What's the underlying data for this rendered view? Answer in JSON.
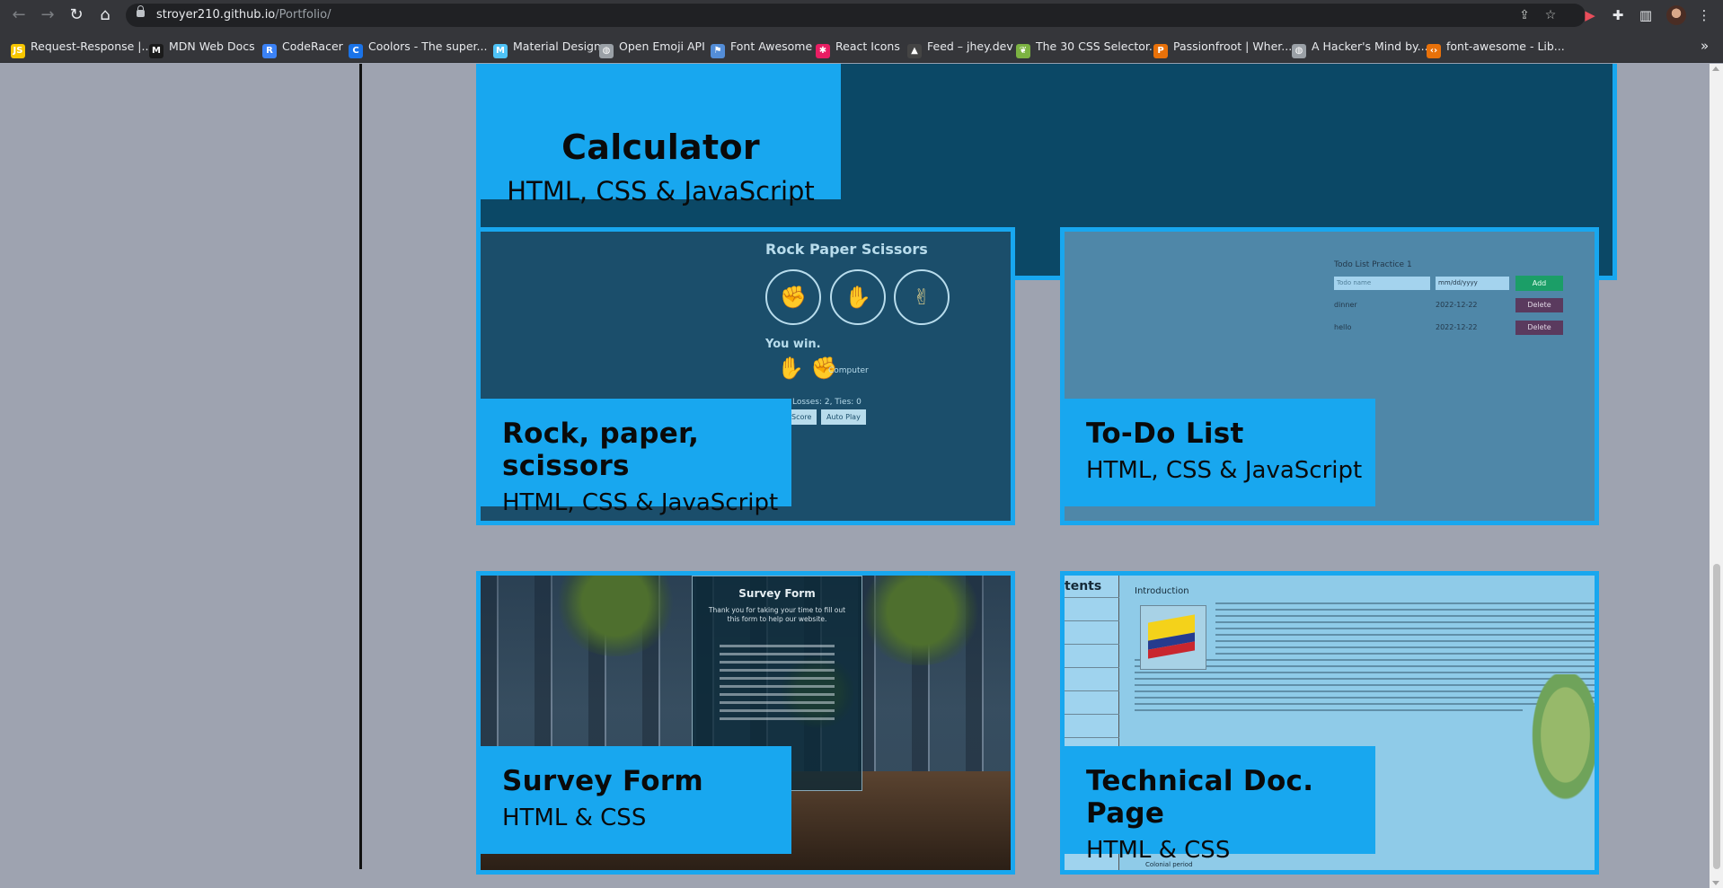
{
  "browser": {
    "url_host": "stroyer210.github.io",
    "url_path": "/Portfolio/",
    "bookmarks": [
      {
        "label": "Request-Response |...",
        "icon": "js-icon",
        "color": "#f7c600"
      },
      {
        "label": "MDN Web Docs",
        "icon": "mdn-icon",
        "color": "#1b1b1b"
      },
      {
        "label": "CodeRacer",
        "icon": "coderacer-icon",
        "color": "#3b82f6"
      },
      {
        "label": "Coolors - The super...",
        "icon": "coolors-icon",
        "color": "#1a73e8"
      },
      {
        "label": "Material Design",
        "icon": "material-icon",
        "color": "#4fc3f7"
      },
      {
        "label": "Open Emoji API",
        "icon": "globe-icon",
        "color": "#9aa0a6"
      },
      {
        "label": "Font Awesome",
        "icon": "flag-icon",
        "color": "#538dd7"
      },
      {
        "label": "React Icons",
        "icon": "react-icon",
        "color": "#e91e63"
      },
      {
        "label": "Feed – jhey.dev",
        "icon": "bear-icon",
        "color": "#444"
      },
      {
        "label": "The 30 CSS Selector...",
        "icon": "leaf-icon",
        "color": "#7cb342"
      },
      {
        "label": "Passionfroot | Wher...",
        "icon": "passionfroot-icon",
        "color": "#e8710a"
      },
      {
        "label": "A Hacker's Mind by...",
        "icon": "globe-icon",
        "color": "#9aa0a6"
      },
      {
        "label": "font-awesome - Lib...",
        "icon": "code-icon",
        "color": "#e8710a"
      }
    ]
  },
  "projects": {
    "calculator": {
      "title": "Calculator",
      "tech": "HTML, CSS & JavaScript"
    },
    "rps": {
      "title": "Rock, paper, scissors",
      "tech": "HTML, CSS & JavaScript",
      "preview": {
        "heading": "Rock Paper Scissors",
        "result": "You win.",
        "computer": "Computer",
        "score": "Losses: 2, Ties: 0",
        "reset": "Score",
        "autoplay": "Auto Play"
      }
    },
    "todo": {
      "title": "To-Do List",
      "tech": "HTML, CSS & JavaScript",
      "preview": {
        "heading": "Todo List Practice 1",
        "name_placeholder": "Todo name",
        "date_placeholder": "mm/dd/yyyy",
        "add": "Add",
        "items": [
          {
            "name": "dinner",
            "date": "2022-12-22",
            "action": "Delete"
          },
          {
            "name": "hello",
            "date": "2022-12-22",
            "action": "Delete"
          }
        ]
      }
    },
    "survey": {
      "title": "Survey Form",
      "tech": "HTML & CSS",
      "preview": {
        "heading": "Survey Form",
        "sub": "Thank you for taking your time to fill out this form to help our website."
      }
    },
    "techdoc": {
      "title": "Technical Doc. Page",
      "tech": "HTML & CSS",
      "preview": {
        "nav_title": "tents",
        "intro": "Introduction",
        "footer": "Colonial period"
      }
    }
  }
}
